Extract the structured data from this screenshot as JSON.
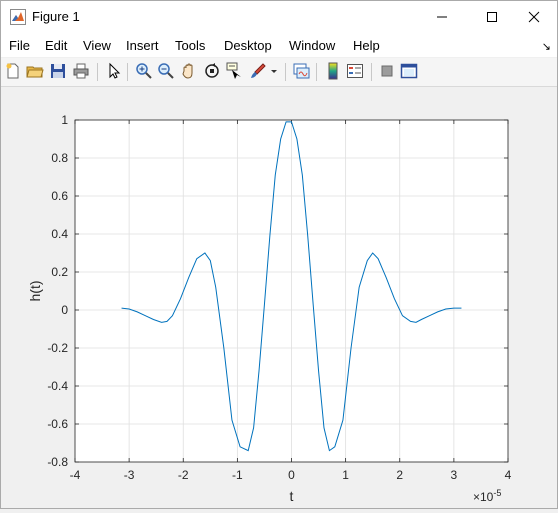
{
  "window": {
    "title": "Figure 1",
    "minimize_glyph": "—",
    "maximize_glyph": "☐",
    "close_glyph": "✕"
  },
  "menu": {
    "items": [
      "File",
      "Edit",
      "View",
      "Insert",
      "Tools",
      "Desktop",
      "Window",
      "Help"
    ],
    "overflow_glyph": "↘"
  },
  "toolbar": {
    "icons": [
      "new-figure-icon",
      "open-file-icon",
      "save-icon",
      "print-icon",
      "edit-plot-icon",
      "zoom-in-icon",
      "zoom-out-icon",
      "pan-icon",
      "rotate-3d-icon",
      "data-cursor-icon",
      "brush-icon",
      "brush-dropdown-icon",
      "link-plot-icon",
      "colorbar-icon",
      "legend-icon",
      "hide-plot-tools-icon",
      "show-plot-tools-icon"
    ]
  },
  "colors": {
    "line": "#0072bd",
    "grid": "#dfdfdf",
    "axes_bg": "#ffffff",
    "figure_bg": "#f0f0f0"
  },
  "chart_data": {
    "type": "line",
    "title": "",
    "xlabel": "t",
    "ylabel": "h(t)",
    "x_exponent_label": "×10",
    "x_exponent_power": "-5",
    "xlim": [
      -4,
      4
    ],
    "ylim": [
      -0.8,
      1
    ],
    "x_scale": 1e-05,
    "xticks": [
      -4,
      -3,
      -2,
      -1,
      0,
      1,
      2,
      3,
      4
    ],
    "xtick_labels": [
      "-4",
      "-3",
      "-2",
      "-1",
      "0",
      "1",
      "2",
      "3",
      "4"
    ],
    "yticks": [
      -0.8,
      -0.6,
      -0.4,
      -0.2,
      0,
      0.2,
      0.4,
      0.6,
      0.8,
      1
    ],
    "ytick_labels": [
      "-0.8",
      "-0.6",
      "-0.4",
      "-0.2",
      "0",
      "0.2",
      "0.4",
      "0.6",
      "0.8",
      "1"
    ],
    "grid": true,
    "series": [
      {
        "x": [
          -3.14,
          -3.0,
          -2.85,
          -2.7,
          -2.55,
          -2.4,
          -2.3,
          -2.2,
          -2.05,
          -1.9,
          -1.75,
          -1.6,
          -1.5,
          -1.4,
          -1.25,
          -1.1,
          -0.95,
          -0.8,
          -0.7,
          -0.6,
          -0.5,
          -0.4,
          -0.3,
          -0.2,
          -0.1,
          0.0,
          0.1,
          0.2,
          0.3,
          0.4,
          0.5,
          0.6,
          0.7,
          0.8,
          0.95,
          1.1,
          1.25,
          1.4,
          1.5,
          1.6,
          1.75,
          1.9,
          2.05,
          2.2,
          2.3,
          2.4,
          2.55,
          2.7,
          2.85,
          3.0,
          3.14
        ],
        "y": [
          0.01,
          0.005,
          -0.01,
          -0.03,
          -0.05,
          -0.065,
          -0.06,
          -0.03,
          0.06,
          0.17,
          0.27,
          0.3,
          0.26,
          0.12,
          -0.2,
          -0.58,
          -0.72,
          -0.74,
          -0.62,
          -0.32,
          0.03,
          0.39,
          0.71,
          0.9,
          0.99,
          0.99,
          0.9,
          0.71,
          0.39,
          0.03,
          -0.32,
          -0.62,
          -0.74,
          -0.72,
          -0.58,
          -0.2,
          0.12,
          0.26,
          0.3,
          0.27,
          0.17,
          0.06,
          -0.03,
          -0.06,
          -0.065,
          -0.05,
          -0.03,
          -0.01,
          0.005,
          0.01,
          0.01
        ]
      }
    ]
  }
}
